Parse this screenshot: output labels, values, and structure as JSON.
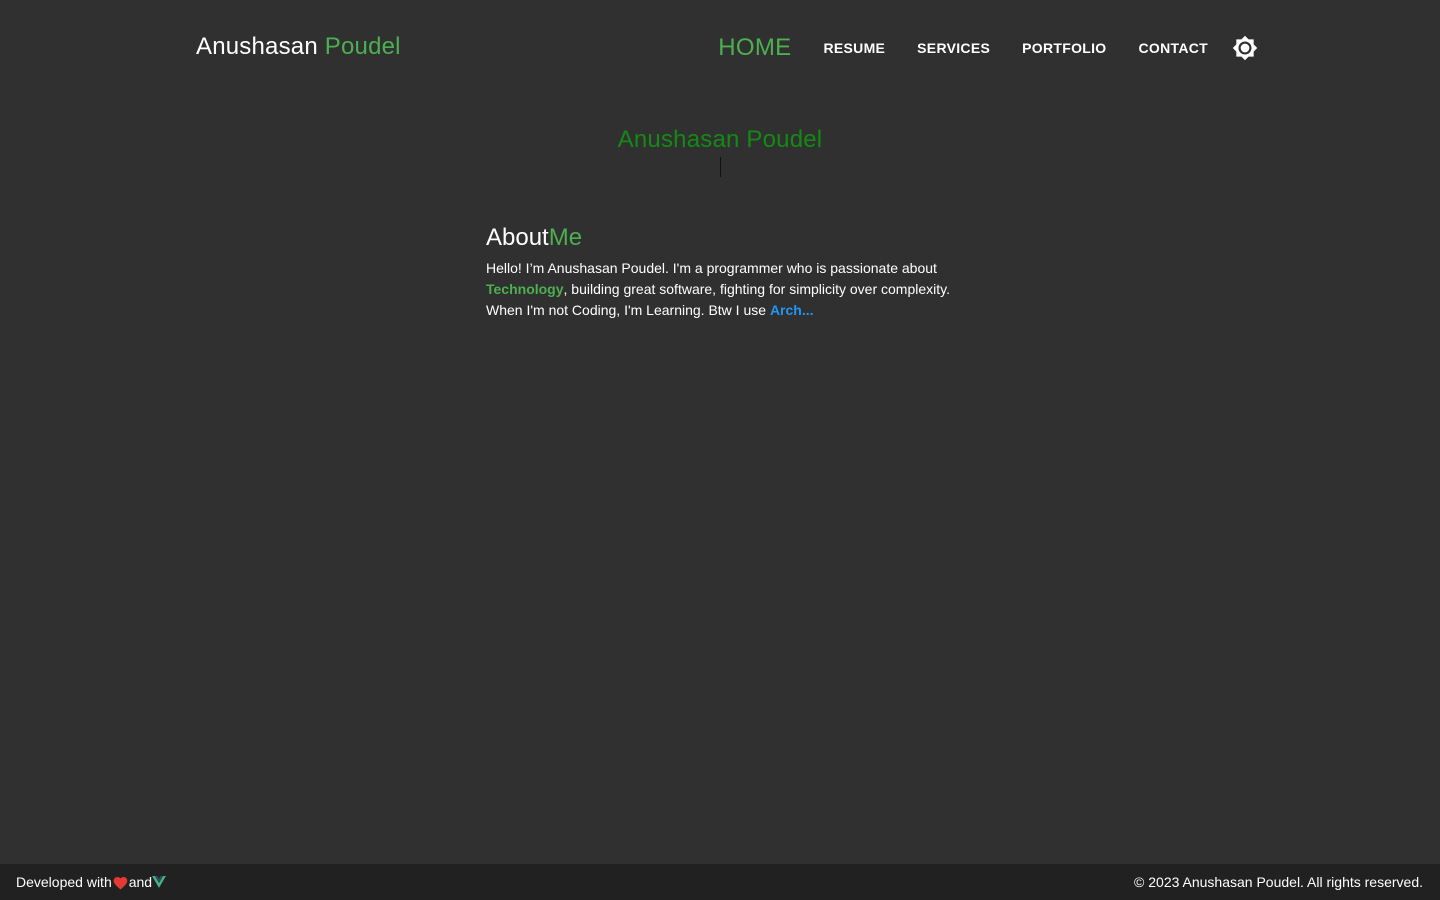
{
  "colors": {
    "background": "#303030",
    "accent_green": "#4caf50",
    "hero_green": "#138a13",
    "link_blue": "#2196f3",
    "footer_bg": "#212121",
    "heart_red": "#e53935"
  },
  "header": {
    "brand_first": "Anushasan",
    "brand_last": "Poudel",
    "nav": [
      {
        "label": "HOME",
        "active": true
      },
      {
        "label": "RESUME"
      },
      {
        "label": "SERVICES"
      },
      {
        "label": "PORTFOLIO"
      },
      {
        "label": "CONTACT"
      }
    ],
    "theme_icon": "sun-icon"
  },
  "hero": {
    "name": "Anushasan Poudel"
  },
  "about": {
    "title_main": "About",
    "title_accent": "Me",
    "text_part1": "Hello! I’m Anushasan Poudel. I'm a programmer who is passionate about ",
    "highlight_technology": "Technology",
    "text_part2": ", building great software, fighting for simplicity over complexity. When I'm not Coding, I'm Learning. Btw I use ",
    "highlight_arch": "Arch..."
  },
  "footer": {
    "developed_with": "Developed with",
    "and": "and",
    "heart_icon": "heart-icon",
    "vue_icon": "vue-icon",
    "copyright": "© 2023 Anushasan Poudel. All rights reserved."
  }
}
